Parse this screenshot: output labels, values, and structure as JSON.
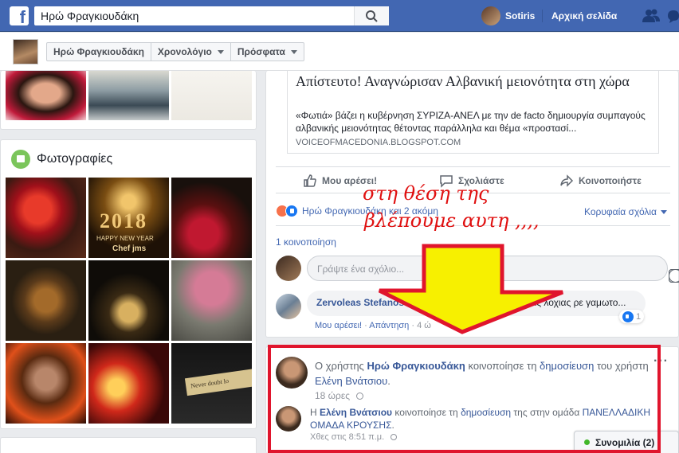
{
  "topbar": {
    "logo_text": "f",
    "search_value": "Ηρώ Φραγκιουδάκη",
    "user_name": "Sotiris",
    "home_label": "Αρχική σελίδα"
  },
  "profile_nav": {
    "name": "Ηρώ Φραγκιουδάκη",
    "timeline": "Χρονολόγιο",
    "recent": "Πρόσφατα"
  },
  "photos_section": {
    "title": "Φωτογραφίες"
  },
  "post": {
    "link_title": "Απίστευτο! Αναγνώρισαν Αλβανική μειονότητα στη χώρα",
    "link_description": "«Φωτιά» βάζει η κυβέρνηση ΣΥΡΙΖΑ-ΑΝΕΛ με την de facto δημιουργία συμπαγούς αλβανικής μειονότητας θέτοντας παράλληλα και θέμα «προστασί...",
    "link_domain": "VOICEOFMACEDONIA.BLOGSPOT.COM",
    "like_action": "Μου αρέσει!",
    "comment_action": "Σχολιάστε",
    "share_action": "Κοινοποιήστε",
    "reactions_text": "Ηρώ Φραγκιουδάκη και 2 ακόμη",
    "top_comments": "Κορυφαία σχόλια",
    "shares_count": "1 κοινοποίηση",
    "comment_placeholder": "Γράψτε ένα σχόλιο...",
    "comment": {
      "author": "Zervoleas Stefanos",
      "text_visible": "ένας λοχιας ρε γαμωτο...",
      "like": "Μου αρέσει!",
      "reply": "Απάντηση",
      "time": "4 ώ",
      "like_count": "1"
    }
  },
  "shared_post": {
    "prefix": "Ο χρήστης",
    "sharer": "Ηρώ Φραγκιουδάκη",
    "shared_verb": "κοινοποίησε τη",
    "post_link": "δημοσίευση",
    "of_user": "του χρήστη",
    "original_author": "Ελένη Βνάτσιου",
    "time": "18 ώρες",
    "sub": {
      "prefix": "Η",
      "author": "Ελένη Βνάτσιου",
      "verb": "κοινοποίησε τη",
      "post_link": "δημοσίευση",
      "in_group": "της στην ομάδα",
      "group": "ΠΑΝΕΛΛΑΔΙΚΗ ΟΜΑΔΑ ΚΡΟΥΣΗΣ",
      "time": "Χθες στις 8:51 π.μ."
    }
  },
  "chat": {
    "label": "Συνομιλία (2)"
  },
  "annotation": {
    "line1": "στη θέση της",
    "line2": "βλέπουμε    αυτη ,,,,"
  },
  "photo_tiles": [
    {
      "overlay": "2018"
    },
    {
      "overlay": "HAPPY NEW YEAR"
    },
    {
      "overlay": "Chef jms"
    },
    {
      "overlay": "Never doubt lo"
    }
  ],
  "colors": {
    "fb_blue": "#4267b2",
    "link_blue": "#385898",
    "annotation_red": "#e0152d",
    "arrow_yellow": "#f7f000"
  }
}
